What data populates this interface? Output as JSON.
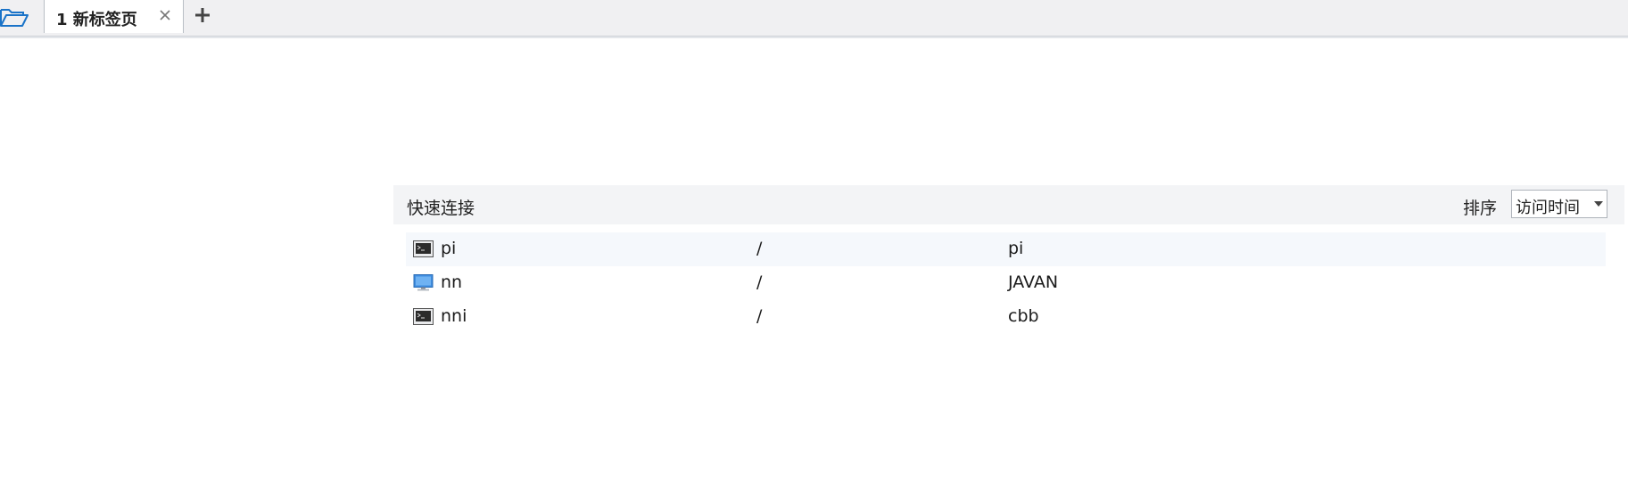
{
  "tabs": [
    {
      "label": "1 新标签页",
      "active": true
    }
  ],
  "quick_connect": {
    "title": "快速连接",
    "sort_label": "排序",
    "sort_value": "访问时间"
  },
  "sessions": [
    {
      "name": "pi",
      "path": "/",
      "user": "pi",
      "icon": "terminal-icon"
    },
    {
      "name": "nn",
      "path": "/",
      "user": "JAVAN",
      "icon": "monitor-icon"
    },
    {
      "name": "nni",
      "path": "/",
      "user": "cbb",
      "icon": "terminal-icon"
    }
  ],
  "colors": {
    "accent": "#1a73c8",
    "tabbar_bg": "#f0f0f2",
    "panel_header_bg": "#f3f4f6",
    "row_highlight": "#f5f8fc"
  }
}
